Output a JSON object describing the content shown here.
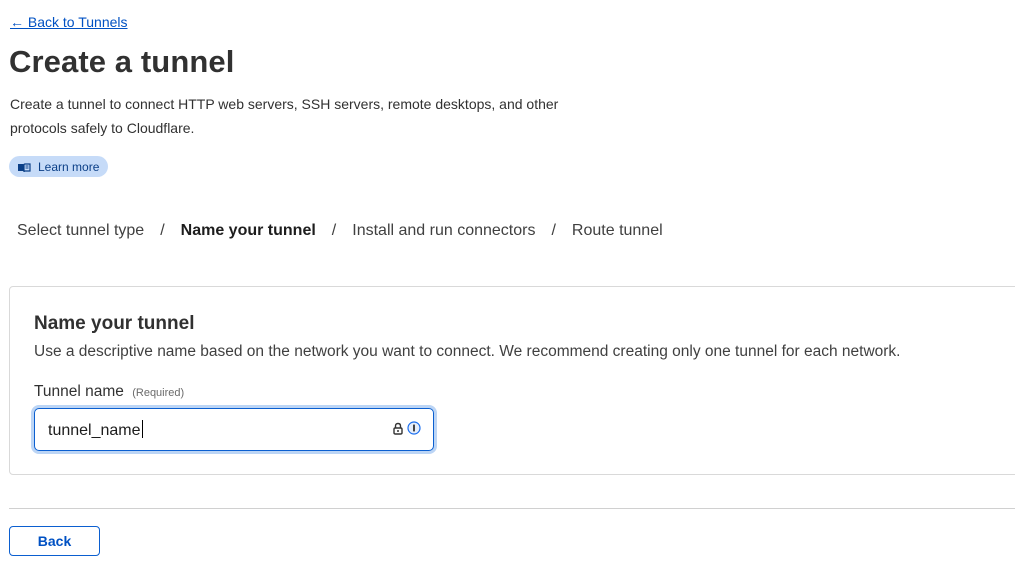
{
  "nav": {
    "back_link": "← Back to Tunnels"
  },
  "header": {
    "title": "Create a tunnel",
    "description": "Create a tunnel to connect HTTP web servers, SSH servers, remote desktops, and other protocols safely to Cloudflare.",
    "learn_more": "Learn more",
    "learn_more_icon": "book-icon"
  },
  "steps": [
    {
      "label": "Select tunnel type",
      "active": false
    },
    {
      "label": "Name your tunnel",
      "active": true
    },
    {
      "label": "Install and run connectors",
      "active": false
    },
    {
      "label": "Route tunnel",
      "active": false
    }
  ],
  "step_separator": "/",
  "card": {
    "title": "Name your tunnel",
    "description": "Use a descriptive name based on the network you want to connect. We recommend creating only one tunnel for each network.",
    "field_label": "Tunnel name",
    "field_required": "(Required)",
    "field_value": "tunnel_name",
    "password_manager_icons": [
      "lock-icon",
      "password-manager-icon"
    ]
  },
  "footer": {
    "back_button": "Back"
  },
  "colors": {
    "link": "#0051c3",
    "accent": "#0b5fd0",
    "badge_bg": "#c6dbf8",
    "text": "#313131"
  }
}
